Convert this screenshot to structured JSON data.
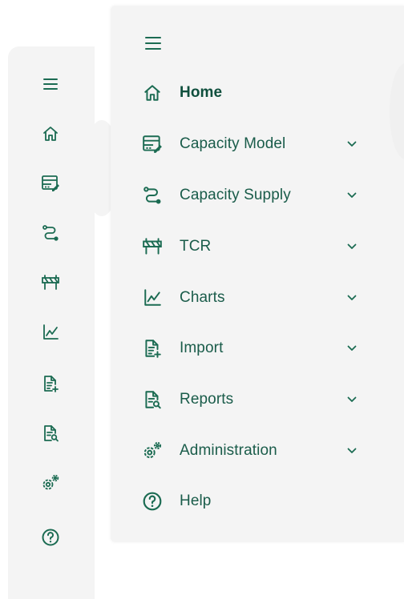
{
  "colors": {
    "accent": "#1b6b52",
    "text": "#1a5c4a",
    "panel_bg": "#f4f4f4"
  },
  "rail": {
    "icons": [
      "hamburger-icon",
      "home-icon",
      "capacity-model-icon",
      "capacity-supply-icon",
      "tcr-icon",
      "charts-icon",
      "import-icon",
      "reports-icon",
      "administration-icon",
      "help-icon"
    ]
  },
  "panel": {
    "menu_icon": "hamburger-icon",
    "items": [
      {
        "label": "Home",
        "icon": "home-icon",
        "active": true,
        "expandable": false
      },
      {
        "label": "Capacity Model",
        "icon": "capacity-model-icon",
        "expandable": true
      },
      {
        "label": "Capacity Supply",
        "icon": "capacity-supply-icon",
        "expandable": true
      },
      {
        "label": "TCR",
        "icon": "tcr-icon",
        "expandable": true
      },
      {
        "label": "Charts",
        "icon": "charts-icon",
        "expandable": true
      },
      {
        "label": "Import",
        "icon": "import-icon",
        "expandable": true
      },
      {
        "label": "Reports",
        "icon": "reports-icon",
        "expandable": true
      },
      {
        "label": "Administration",
        "icon": "administration-icon",
        "expandable": true
      },
      {
        "label": "Help",
        "icon": "help-icon",
        "expandable": false
      }
    ]
  }
}
